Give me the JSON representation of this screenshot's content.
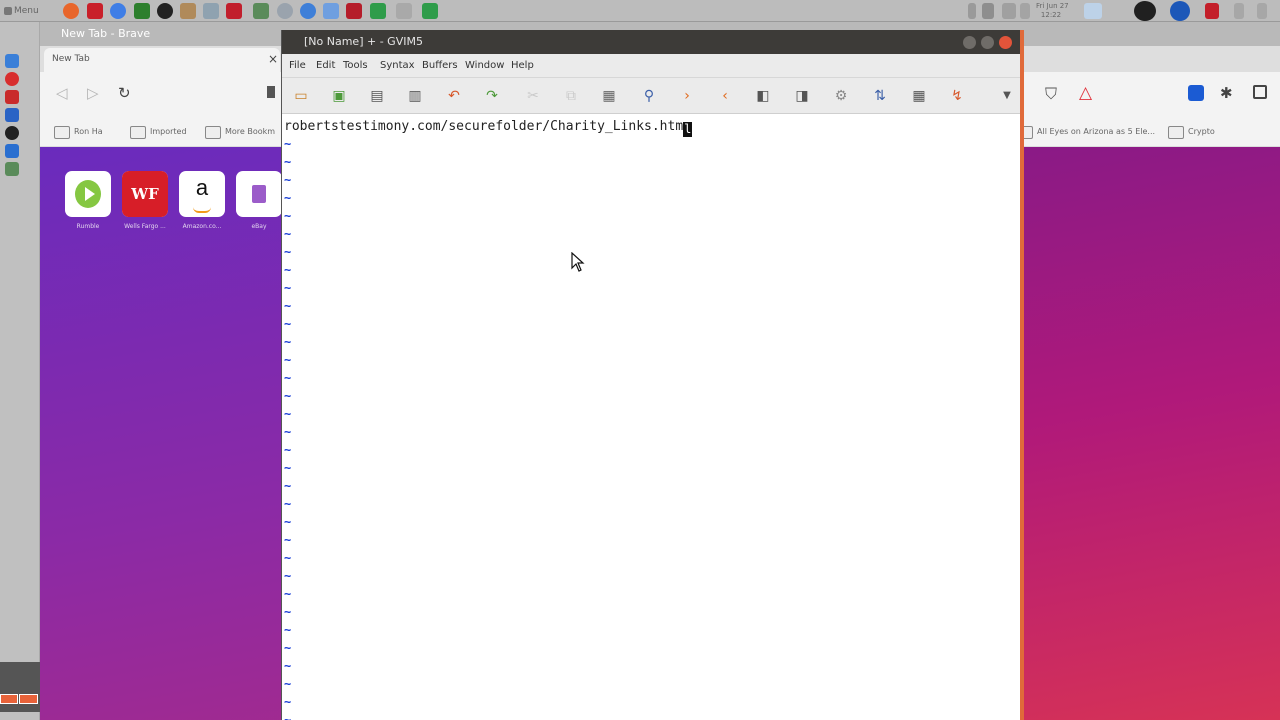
{
  "panel": {
    "menu_label": "Menu",
    "clock": "Fri Jun 27\n12:22"
  },
  "brave": {
    "window_title": "New Tab - Brave",
    "tab_label": "New Tab",
    "tab_close": "×",
    "nav": {
      "back": "◁",
      "forward": "▷",
      "reload": "↻"
    },
    "bookmarks": [
      {
        "label": "Ron Ha"
      },
      {
        "label": "Imported"
      },
      {
        "label": "More Bookm"
      },
      {
        "label": "All Eyes on Arizona as 5 Ele..."
      },
      {
        "label": "Crypto"
      }
    ],
    "shield_icon": "shield-icon",
    "rewards_icon": "brave-rewards-icon",
    "tiles": [
      {
        "name": "Rumble",
        "label": "Rumble",
        "icon": "rumble-icon"
      },
      {
        "name": "Wells Fargo",
        "label": "Wells Fargo ...",
        "icon": "wells-fargo-icon",
        "glyph": "WF"
      },
      {
        "name": "Amazon",
        "label": "Amazon.co...",
        "icon": "amazon-icon",
        "glyph": "a"
      },
      {
        "name": "eBay",
        "label": "eBay",
        "icon": "ebay-icon"
      }
    ]
  },
  "gvim": {
    "window_title": "[No Name] + - GVIM5",
    "menu": [
      "File",
      "Edit",
      "Tools",
      "Syntax",
      "Buffers",
      "Window",
      "Help"
    ],
    "buffer_line": "robertstestimony.com/securefolder/Charity_Links.htm",
    "cursor_char": "l",
    "empty_marker": "~",
    "toolbar_icons": [
      "open-icon",
      "save-icon",
      "save-all-icon",
      "print-icon",
      "undo-icon",
      "redo-icon",
      "cut-icon",
      "copy-icon",
      "paste-icon",
      "find-replace-icon",
      "find-next-icon",
      "find-prev-icon",
      "load-session-icon",
      "save-session-icon",
      "run-script-icon",
      "make-icon",
      "run-ctags-icon",
      "jump-tag-icon",
      "overflow-icon"
    ]
  },
  "colors": {
    "vim_tilde": "#1a3fd6",
    "gvim_accent": "#e06a3a",
    "brave_gradient_start": "#6a2bbd",
    "brave_gradient_end": "#b02b80"
  }
}
